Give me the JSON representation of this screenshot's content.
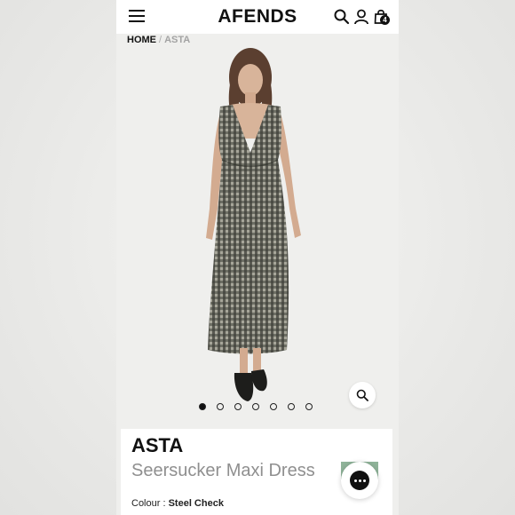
{
  "header": {
    "logo": "AFENDS",
    "menu_icon": "hamburger-menu-icon",
    "search_icon": "search-icon",
    "account_icon": "user-icon",
    "cart_icon": "shopping-bag-icon",
    "cart_count": "4"
  },
  "breadcrumb": {
    "home": "HOME",
    "separator": "/",
    "current": "ASTA"
  },
  "gallery": {
    "image_count": 7,
    "active_index": 0,
    "zoom_icon": "magnifier-icon"
  },
  "product": {
    "name": "ASTA",
    "subtitle": "Seersucker Maxi Dress",
    "colour_label": "Colour : ",
    "colour_value": "Steel Check",
    "swatch_color": "#8fb399"
  },
  "chat": {
    "icon": "chat-icon"
  },
  "colors": {
    "brand": "#111111",
    "background": "#efefed",
    "muted_text": "#8f8f8f"
  }
}
